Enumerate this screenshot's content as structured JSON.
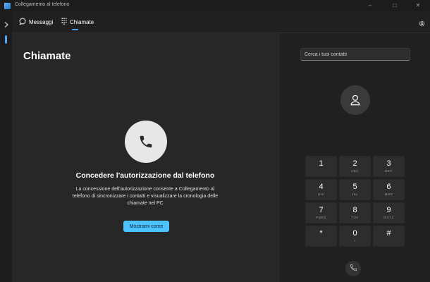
{
  "window": {
    "title": "Collegamento al telefono",
    "icon": "phone-link-app-icon",
    "controls": [
      "minimize-icon",
      "maximize-icon",
      "close-icon"
    ]
  },
  "rail": {
    "expand_icon": "chevron-right-icon"
  },
  "tabs": [
    {
      "label": "Messaggi",
      "icon": "message-icon",
      "active": false
    },
    {
      "label": "Chiamate",
      "icon": "dialpad-icon",
      "active": true
    }
  ],
  "settings_icon": "gear-icon",
  "main": {
    "title": "Chiamate",
    "permission_title": "Concedere l'autorizzazione dal telefono",
    "permission_text": "La concessione dell'autorizzazione consente a Collegamento al telefono di sincronizzare i contatti e visualizzare la cronologia delle chiamate nel PC",
    "button_label": "Mostrami come"
  },
  "dialer": {
    "search_placeholder": "Cerca i tuoi contatti",
    "avatar_icon": "person-icon",
    "keys": [
      {
        "digit": "1",
        "letters": ""
      },
      {
        "digit": "2",
        "letters": "ABC"
      },
      {
        "digit": "3",
        "letters": "DEF"
      },
      {
        "digit": "4",
        "letters": "GHI"
      },
      {
        "digit": "5",
        "letters": "JKL"
      },
      {
        "digit": "6",
        "letters": "MNO"
      },
      {
        "digit": "7",
        "letters": "PQRS"
      },
      {
        "digit": "8",
        "letters": "TUV"
      },
      {
        "digit": "9",
        "letters": "WXYZ"
      },
      {
        "digit": "*",
        "letters": ""
      },
      {
        "digit": "0",
        "letters": "+"
      },
      {
        "digit": "#",
        "letters": ""
      }
    ],
    "call_icon": "phone-call-icon"
  },
  "colors": {
    "accent": "#4cc2ff",
    "window_bg": "#202020",
    "pane_bg": "#272727",
    "key_bg": "#2d2d2d"
  }
}
